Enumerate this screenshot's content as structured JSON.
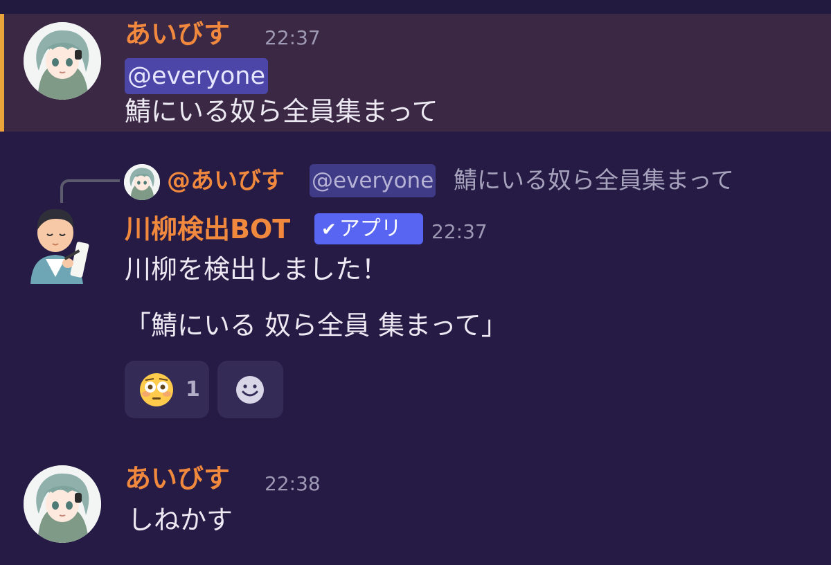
{
  "colors": {
    "background": "#251b45",
    "highlight_background": "#3b2844",
    "highlight_bar": "#e9a43a",
    "username": "#f0883e",
    "timestamp": "#9d98b3",
    "mention_bg": "#4b46a8",
    "app_badge": "#5865f2",
    "reaction_bg": "#342b56"
  },
  "messages": [
    {
      "author": "あいびす",
      "timestamp": "22:37",
      "mention": "@everyone",
      "text": "鯖にいる奴ら全員集まって",
      "highlighted": true,
      "avatar_icon": "anime-avatar-icon"
    },
    {
      "reply": {
        "author": "@あいびす",
        "mention": "@everyone",
        "text": "鯖にいる奴ら全員集まって",
        "avatar_icon": "anime-avatar-icon"
      },
      "author": "川柳検出BOT",
      "badge": "アプリ",
      "badge_icon": "checkmark-icon",
      "timestamp": "22:37",
      "line1": "川柳を検出しました！",
      "line2": "「鯖にいる 奴ら全員 集まって」",
      "avatar_icon": "poet-avatar-icon",
      "reactions": [
        {
          "emoji": "😳",
          "icon": "flushed-face-emoji",
          "count": "1"
        },
        {
          "icon": "add-reaction-icon"
        }
      ]
    },
    {
      "author": "あいびす",
      "timestamp": "22:38",
      "text": "しねかす",
      "avatar_icon": "anime-avatar-icon"
    }
  ]
}
